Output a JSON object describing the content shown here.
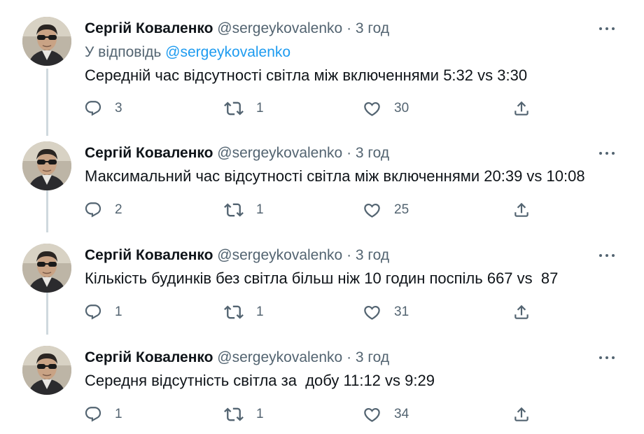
{
  "colors": {
    "text": "#0f1419",
    "secondary": "#536471",
    "link": "#1d9bf0",
    "thread_line": "#cfd9de"
  },
  "icons": {
    "reply": "reply-icon",
    "retweet": "retweet-icon",
    "like": "heart-icon",
    "share": "share-icon",
    "more": "more-icon"
  },
  "tweets": [
    {
      "name": "Сергій Коваленко",
      "handle": "@sergeykovalenko",
      "dot": "·",
      "time": "3 год",
      "reply_prefix": "У відповідь",
      "reply_mention": "@sergeykovalenko",
      "text": "Середній час відсутності світла між включеннями 5:32 vs 3:30",
      "replies": "3",
      "retweets": "1",
      "likes": "30"
    },
    {
      "name": "Сергій Коваленко",
      "handle": "@sergeykovalenko",
      "dot": "·",
      "time": "3 год",
      "text": "Максимальний час відсутності світла між включеннями 20:39 vs 10:08",
      "replies": "2",
      "retweets": "1",
      "likes": "25"
    },
    {
      "name": "Сергій Коваленко",
      "handle": "@sergeykovalenko",
      "dot": "·",
      "time": "3 год",
      "text": "Кількість будинків без світла більш ніж 10 годин поспіль 667 vs  87",
      "replies": "1",
      "retweets": "1",
      "likes": "31"
    },
    {
      "name": "Сергій Коваленко",
      "handle": "@sergeykovalenko",
      "dot": "·",
      "time": "3 год",
      "text": "Середня відсутність світла за  добу 11:12 vs 9:29",
      "replies": "1",
      "retweets": "1",
      "likes": "34"
    }
  ]
}
